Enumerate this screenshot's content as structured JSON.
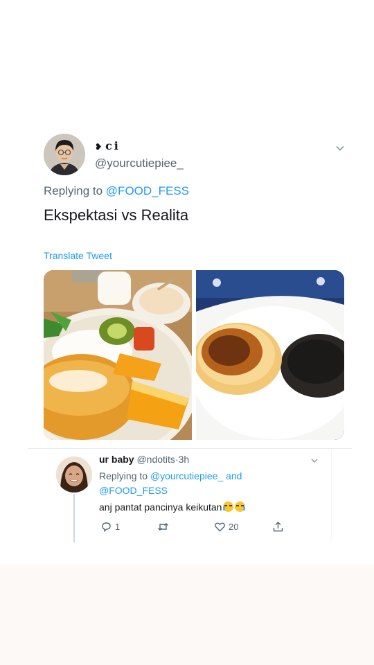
{
  "tweet": {
    "display_name": "ci",
    "handle": "@yourcutiepiee_",
    "replying_prefix": "Replying to",
    "replying_to": "@FOOD_FESS",
    "text": "Ekspektasi vs Realita",
    "translate_label": "Translate Tweet",
    "media": [
      "expectation-pancake-photo",
      "reality-burnt-pancake-photo"
    ]
  },
  "reply": {
    "display_name": "ur baby",
    "handle": "@ndotits",
    "separator": "·",
    "time": "3h",
    "replying_prefix": "Replying to",
    "mention_1": "@yourcutiepiee_",
    "and_word": "and",
    "mention_2": "@FOOD_FESS",
    "text": "anj pantat pancinya keikutan",
    "emojis": [
      "joy-emoji",
      "joy-emoji"
    ],
    "reply_count": "1",
    "retweet_count": "",
    "like_count": "20"
  },
  "icons": {
    "chevron": "chevron-down-icon",
    "reply": "reply-icon",
    "retweet": "retweet-icon",
    "like": "heart-icon",
    "share": "share-icon"
  },
  "colors": {
    "accent": "#1d9bf0",
    "secondary_text": "#536471",
    "primary_text": "#14171a"
  }
}
